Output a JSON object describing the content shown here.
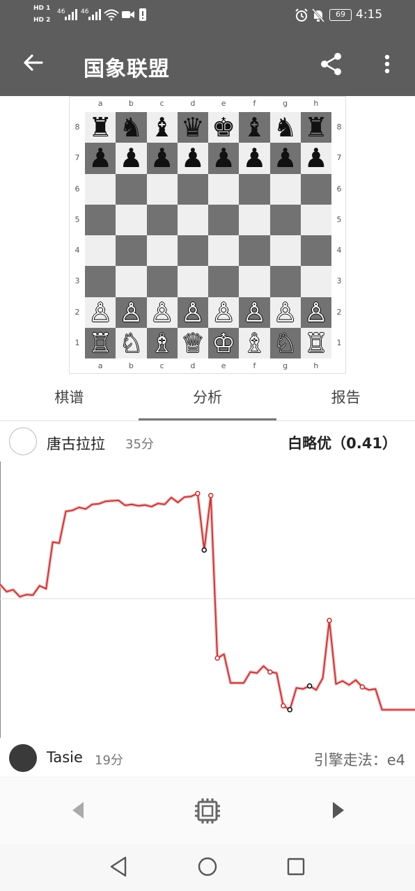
{
  "status_bar": {
    "hd1": "HD 1",
    "hd2": "HD 2",
    "net1": "46",
    "net2": "46",
    "battery": "69",
    "time": "4:15"
  },
  "app_bar": {
    "title": "国象联盟"
  },
  "board": {
    "files": [
      "a",
      "b",
      "c",
      "d",
      "e",
      "f",
      "g",
      "h"
    ],
    "ranks": [
      "8",
      "7",
      "6",
      "5",
      "4",
      "3",
      "2",
      "1"
    ],
    "position": [
      [
        "♜",
        "♞",
        "♝",
        "♛",
        "♚",
        "♝",
        "♞",
        "♜"
      ],
      [
        "♟",
        "♟",
        "♟",
        "♟",
        "♟",
        "♟",
        "♟",
        "♟"
      ],
      [
        "",
        "",
        "",
        "",
        "",
        "",
        "",
        ""
      ],
      [
        "",
        "",
        "",
        "",
        "",
        "",
        "",
        ""
      ],
      [
        "",
        "",
        "",
        "",
        "",
        "",
        "",
        ""
      ],
      [
        "",
        "",
        "",
        "",
        "",
        "",
        "",
        ""
      ],
      [
        "♙",
        "♙",
        "♙",
        "♙",
        "♙",
        "♙",
        "♙",
        "♙"
      ],
      [
        "♖",
        "♘",
        "♗",
        "♕",
        "♔",
        "♗",
        "♘",
        "♖"
      ]
    ]
  },
  "tabs": [
    {
      "label": "棋谱",
      "active": false
    },
    {
      "label": "分析",
      "active": true
    },
    {
      "label": "报告",
      "active": false
    }
  ],
  "player_top": {
    "name": "唐古拉拉",
    "score": "35分",
    "evaluation": "白略优（0.41）"
  },
  "player_bottom": {
    "name": "Tasie",
    "score": "19分",
    "engine_move": "引擎走法：e4"
  },
  "eval_graph": {
    "line_color": "#c0393b",
    "values": [
      0.72,
      0.35,
      0.45,
      0.1,
      0.2,
      0.18,
      0.65,
      0.5,
      2.85,
      2.8,
      4.4,
      4.45,
      4.6,
      4.52,
      4.75,
      4.78,
      4.9,
      4.93,
      4.95,
      4.7,
      4.75,
      4.68,
      4.72,
      4.64,
      4.8,
      4.75,
      5.1,
      4.85,
      5.12,
      5.15,
      5.3,
      2.45,
      5.2,
      -3.0,
      -2.8,
      -4.25,
      -4.25,
      -4.25,
      -3.7,
      -3.75,
      -3.4,
      -3.7,
      -3.75,
      -5.4,
      -5.6,
      -4.5,
      -4.55,
      -4.4,
      -4.6,
      -4.0,
      -1.1,
      -4.3,
      -4.15,
      -4.35,
      -4.1,
      -4.45,
      -4.6,
      -4.55,
      -5.6,
      -5.6,
      -5.6,
      -5.6,
      -5.6,
      -5.6
    ],
    "marked_indices": [
      30,
      31,
      32,
      33,
      41,
      43,
      44,
      47,
      50,
      55
    ],
    "black_markers": [
      31,
      44,
      47
    ]
  },
  "colors": {
    "app_bar": "#5d5d5d",
    "board_light": "#efefef",
    "board_dark": "#727272",
    "accent": "#c0393b"
  }
}
